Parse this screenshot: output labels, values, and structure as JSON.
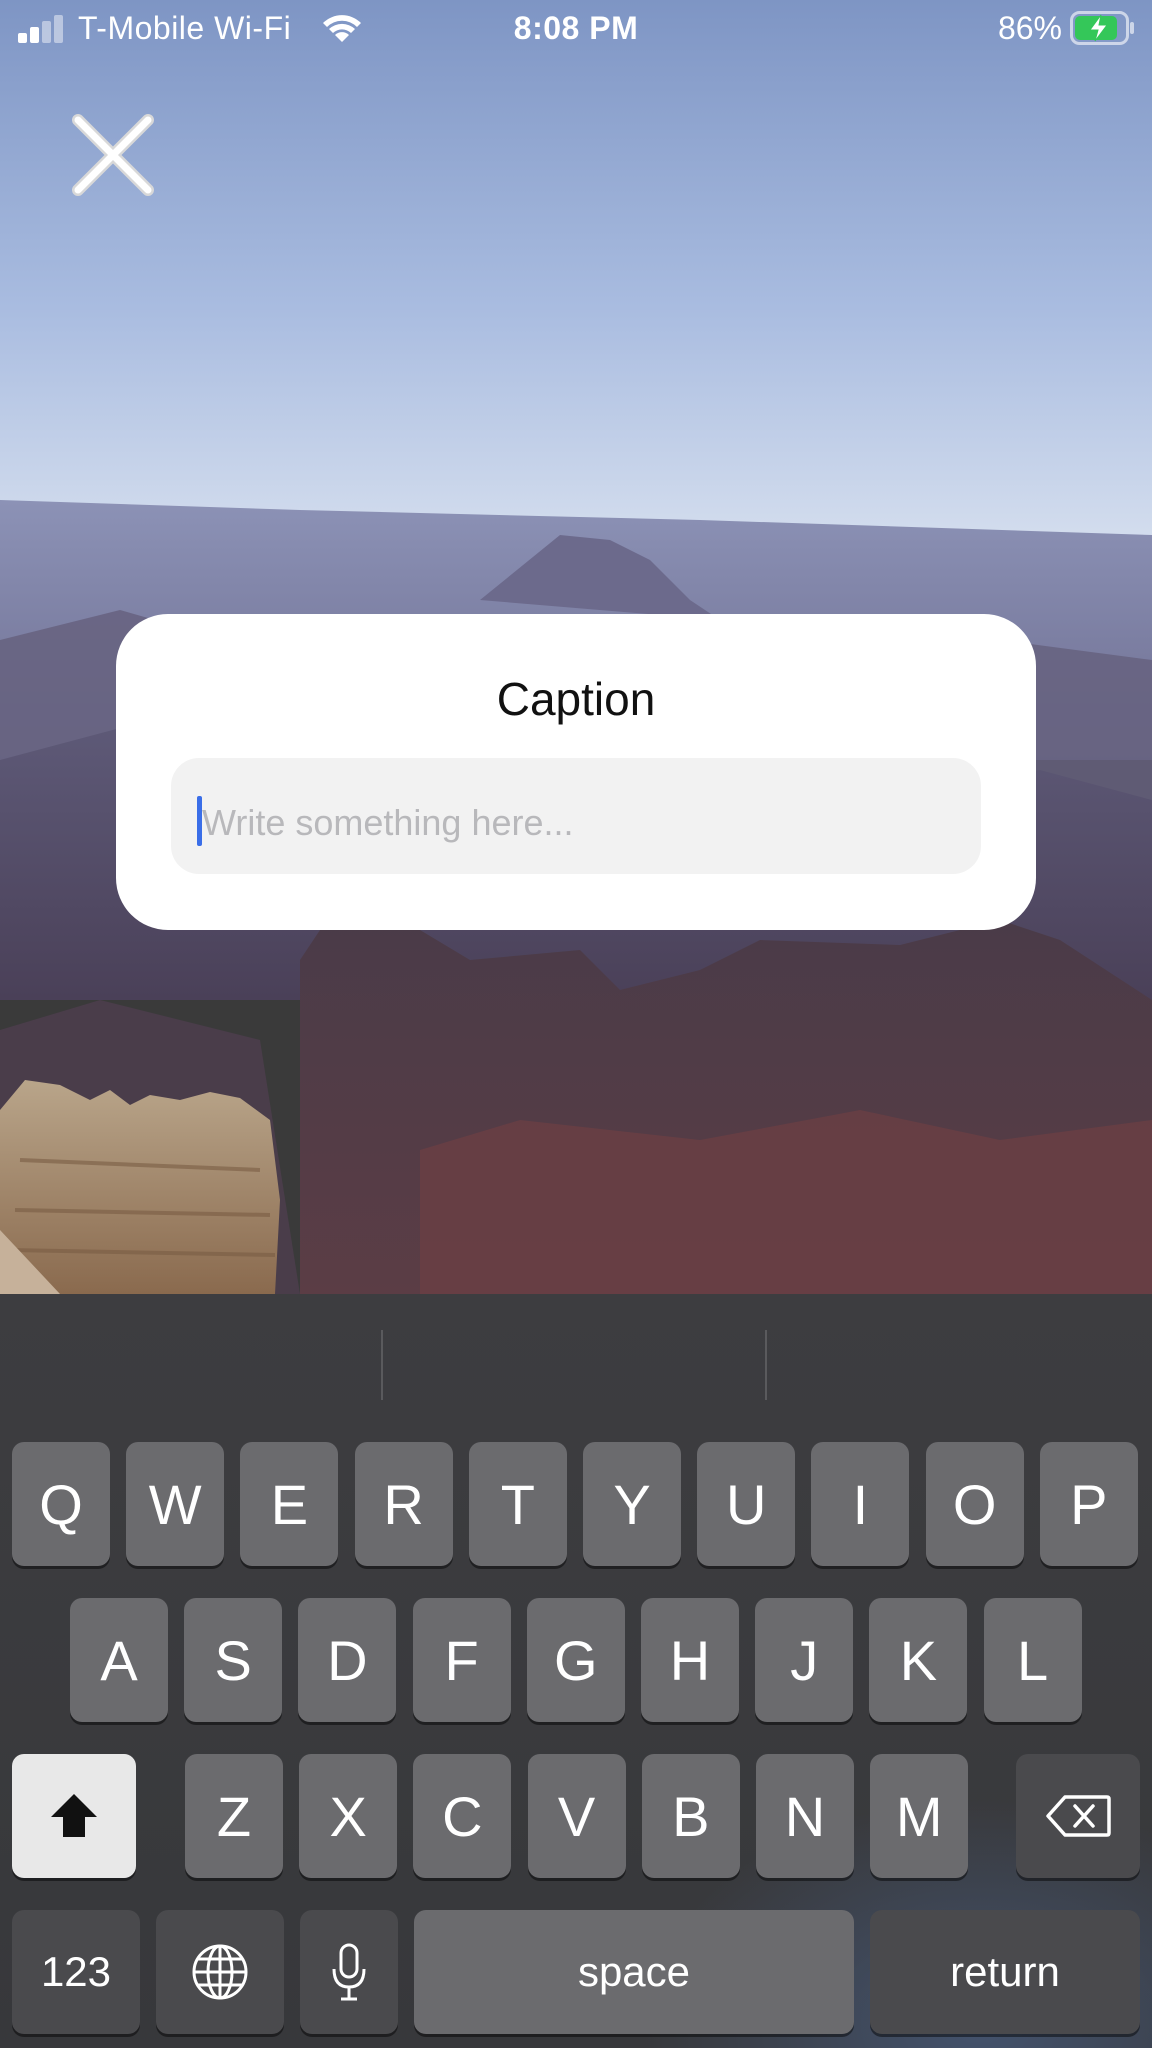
{
  "status_bar": {
    "carrier": "T-Mobile Wi-Fi",
    "time": "8:08 PM",
    "battery_percent": "86%",
    "battery_level": 0.86,
    "signal_bars_active": 2
  },
  "close_button": {
    "icon": "close-icon"
  },
  "caption_dialog": {
    "title": "Caption",
    "input_value": "",
    "placeholder": "Write something here..."
  },
  "keyboard": {
    "row1": [
      "Q",
      "W",
      "E",
      "R",
      "T",
      "Y",
      "U",
      "I",
      "O",
      "P"
    ],
    "row2": [
      "A",
      "S",
      "D",
      "F",
      "G",
      "H",
      "J",
      "K",
      "L"
    ],
    "row3": [
      "Z",
      "X",
      "C",
      "V",
      "B",
      "N",
      "M"
    ],
    "shift_icon": "shift-arrow-icon",
    "backspace_icon": "backspace-icon",
    "numbers_label": "123",
    "globe_icon": "globe-icon",
    "mic_icon": "microphone-icon",
    "space_label": "space",
    "return_label": "return"
  },
  "colors": {
    "cursor": "#3a6ee8",
    "battery_fill": "#34c759",
    "card_background": "#ffffff"
  }
}
